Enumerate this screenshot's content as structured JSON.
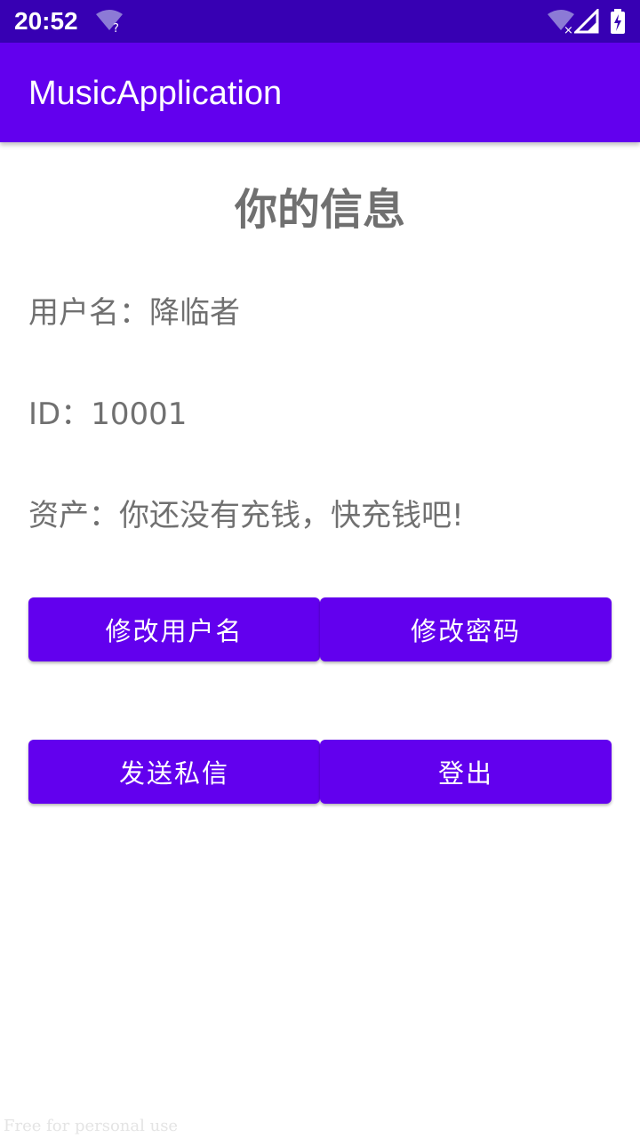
{
  "status_bar": {
    "time": "20:52",
    "icons": [
      "wifi-question-icon",
      "wifi-off-icon",
      "signal-icon",
      "battery-charging-icon"
    ]
  },
  "app_bar": {
    "title": "MusicApplication"
  },
  "page": {
    "title": "你的信息",
    "username_line": "用户名：降临者",
    "id_line": "ID：10001",
    "assets_line": "资产：你还没有充钱，快充钱吧!"
  },
  "buttons": {
    "change_username": "修改用户名",
    "change_password": "修改密码",
    "send_message": "发送私信",
    "logout": "登出"
  },
  "watermark": "Free for personal use",
  "colors": {
    "status_bar": "#3700b3",
    "primary": "#6200ee",
    "text_gray": "#707070"
  }
}
